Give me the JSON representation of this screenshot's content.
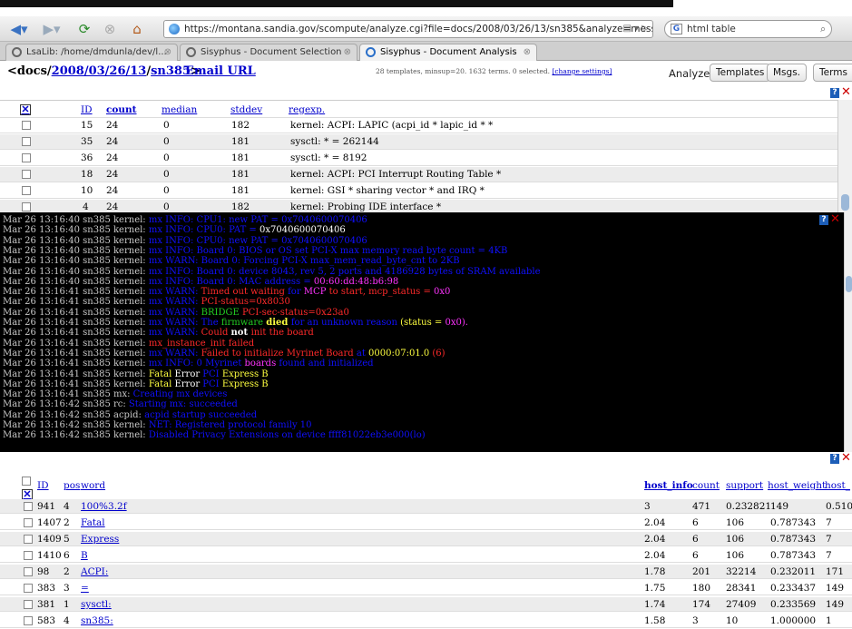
{
  "browser": {
    "url": "https://montana.sandia.gov/scompute/analyze.cgi?file=docs/2008/03/26/13/sn385&analyze=messages",
    "search_text": "html table",
    "tabs": [
      {
        "label": "LsaLib: /home/dmdunla/dev/l..."
      },
      {
        "label": "Sisyphus - Document Selection"
      },
      {
        "label": "Sisyphus - Document Analysis"
      }
    ]
  },
  "header": {
    "crumb_lt": "<",
    "crumb_docs": "docs",
    "crumb_slash1": "/",
    "crumb_date": "2008/03/26/13",
    "crumb_slash2": "/",
    "crumb_host": "sn385",
    "crumb_gt": ">",
    "email_url": "Email URL",
    "stats": "28 templates, minsup=20. 1632 terms. 0 selected.",
    "change_settings": "[change settings]",
    "analyze_label": "Analyze:",
    "buttons": [
      "Templates",
      "Msgs.",
      "Terms"
    ]
  },
  "templates": {
    "columns": {
      "id": "ID",
      "count": "count",
      "median": "median",
      "stddev": "stddev",
      "regexp": "regexp."
    },
    "rows": [
      {
        "id": "15",
        "count": "24",
        "median": "0",
        "stddev": "182",
        "regexp": "kernel: ACPI: LAPIC (acpi_id * lapic_id * *"
      },
      {
        "id": "35",
        "count": "24",
        "median": "0",
        "stddev": "181",
        "regexp": "sysctl: * = 262144"
      },
      {
        "id": "36",
        "count": "24",
        "median": "0",
        "stddev": "181",
        "regexp": "sysctl: * = 8192"
      },
      {
        "id": "18",
        "count": "24",
        "median": "0",
        "stddev": "181",
        "regexp": "kernel: ACPI: PCI Interrupt Routing Table *"
      },
      {
        "id": "10",
        "count": "24",
        "median": "0",
        "stddev": "181",
        "regexp": "kernel: GSI * sharing vector * and IRQ *"
      },
      {
        "id": "4",
        "count": "24",
        "median": "0",
        "stddev": "182",
        "regexp": "kernel: Probing IDE interface *"
      }
    ]
  },
  "log": {
    "lines": [
      {
        "ts": "Mar 26 13:16:40 sn385 kernel:",
        "segs": [
          {
            "t": " mx INFO: CPU1: new PAT = 0x7040600070406",
            "c": "c-blue"
          }
        ]
      },
      {
        "ts": "Mar 26 13:16:40 sn385 kernel:",
        "segs": [
          {
            "t": " mx INFO: CPU0: PAT = ",
            "c": "c-blue"
          },
          {
            "t": "0x7040600070406",
            "c": "c-white"
          }
        ]
      },
      {
        "ts": "Mar 26 13:16:40 sn385 kernel:",
        "segs": [
          {
            "t": " mx INFO: CPU0: new PAT = 0x7040600070406",
            "c": "c-blue"
          }
        ]
      },
      {
        "ts": "Mar 26 13:16:40 sn385 kernel:",
        "segs": [
          {
            "t": " mx INFO: Board 0: BIOS or OS set PCI-X max memory read byte count = 4KB",
            "c": "c-blue"
          }
        ]
      },
      {
        "ts": "Mar 26 13:16:40 sn385 kernel:",
        "segs": [
          {
            "t": " mx WARN: Board 0: Forcing PCI-X max_mem_read_byte_cnt to 2KB",
            "c": "c-blue"
          }
        ]
      },
      {
        "ts": "Mar 26 13:16:40 sn385 kernel:",
        "segs": [
          {
            "t": " mx INFO: Board 0: device 8043, rev 5, 2 ports and 4186928 bytes of SRAM available",
            "c": "c-blue"
          }
        ]
      },
      {
        "ts": "Mar 26 13:16:40 sn385 kernel:",
        "segs": [
          {
            "t": " mx INFO: Board 0: MAC address = ",
            "c": "c-blue"
          },
          {
            "t": "00:60:dd:48:b6:98",
            "c": "c-mag"
          }
        ]
      },
      {
        "ts": "Mar 26 13:16:41 sn385 kernel:",
        "segs": [
          {
            "t": " mx WARN: ",
            "c": "c-blue"
          },
          {
            "t": "Timed out waiting ",
            "c": "c-red"
          },
          {
            "t": "for ",
            "c": "c-blue"
          },
          {
            "t": "MCP ",
            "c": "c-mag"
          },
          {
            "t": "to start, mcp_status = ",
            "c": "c-red"
          },
          {
            "t": "0x0",
            "c": "c-mag"
          }
        ]
      },
      {
        "ts": "Mar 26 13:16:41 sn385 kernel:",
        "segs": [
          {
            "t": " mx WARN: ",
            "c": "c-blue"
          },
          {
            "t": "PCI-status=0x8030",
            "c": "c-red"
          }
        ]
      },
      {
        "ts": "Mar 26 13:16:41 sn385 kernel:",
        "segs": [
          {
            "t": " mx WARN: ",
            "c": "c-blue"
          },
          {
            "t": "BRIDGE ",
            "c": "c-green"
          },
          {
            "t": "PCI-sec-status=0x23a0",
            "c": "c-red"
          }
        ]
      },
      {
        "ts": "Mar 26 13:16:41 sn385 kernel:",
        "segs": [
          {
            "t": " mx WARN: ",
            "c": "c-blue"
          },
          {
            "t": "The ",
            "c": "c-blue"
          },
          {
            "t": "firmware ",
            "c": "c-green"
          },
          {
            "t": "died ",
            "c": "c-yellow c-bold"
          },
          {
            "t": "for an unknown reason ",
            "c": "c-blue"
          },
          {
            "t": "(status = ",
            "c": "c-yellow"
          },
          {
            "t": "0x0).",
            "c": "c-mag"
          }
        ]
      },
      {
        "ts": "Mar 26 13:16:41 sn385 kernel:",
        "segs": [
          {
            "t": " mx WARN: ",
            "c": "c-blue"
          },
          {
            "t": "Could ",
            "c": "c-red"
          },
          {
            "t": "not ",
            "c": "c-white c-bold"
          },
          {
            "t": "init the board",
            "c": "c-red"
          }
        ]
      },
      {
        "ts": "Mar 26 13:16:41 sn385 kernel:",
        "segs": [
          {
            "t": " mx_instance_init failed",
            "c": "c-red"
          }
        ]
      },
      {
        "ts": "Mar 26 13:16:41 sn385 kernel:",
        "segs": [
          {
            "t": " mx WARN: ",
            "c": "c-blue"
          },
          {
            "t": "Failed to initialize Myrinet Board ",
            "c": "c-red"
          },
          {
            "t": "at ",
            "c": "c-blue"
          },
          {
            "t": "0000:07:01.0 ",
            "c": "c-yellow"
          },
          {
            "t": "(6)",
            "c": "c-red"
          }
        ]
      },
      {
        "ts": "Mar 26 13:16:41 sn385 kernel:",
        "segs": [
          {
            "t": " mx INFO: 0 Myrinet ",
            "c": "c-blue"
          },
          {
            "t": "boards ",
            "c": "c-mag"
          },
          {
            "t": "found and initialized",
            "c": "c-blue"
          }
        ]
      },
      {
        "ts": "Mar 26 13:16:41 sn385 kernel:",
        "segs": [
          {
            "t": " Fatal ",
            "c": "c-yellow"
          },
          {
            "t": "Error ",
            "c": "c-white"
          },
          {
            "t": "PCI ",
            "c": "c-blue"
          },
          {
            "t": "Express B",
            "c": "c-yellow"
          }
        ]
      },
      {
        "ts": "Mar 26 13:16:41 sn385 kernel:",
        "segs": [
          {
            "t": " Fatal ",
            "c": "c-yellow"
          },
          {
            "t": "Error ",
            "c": "c-white"
          },
          {
            "t": "PCI ",
            "c": "c-blue"
          },
          {
            "t": "Express B",
            "c": "c-yellow"
          }
        ]
      },
      {
        "ts": "Mar 26 13:16:41 sn385 mx:",
        "segs": [
          {
            "t": " Creating mx devices",
            "c": "c-blue"
          }
        ]
      },
      {
        "ts": "Mar 26 13:16:42 sn385 rc:",
        "segs": [
          {
            "t": " Starting mx: succeeded",
            "c": "c-blue"
          }
        ]
      },
      {
        "ts": "Mar 26 13:16:42 sn385 acpid:",
        "segs": [
          {
            "t": " acpid startup succeeded",
            "c": "c-blue"
          }
        ]
      },
      {
        "ts": "Mar 26 13:16:42 sn385 kernel:",
        "segs": [
          {
            "t": " NET: Registered protocol family 10",
            "c": "c-blue"
          }
        ]
      },
      {
        "ts": "Mar 26 13:16:42 sn385 kernel:",
        "segs": [
          {
            "t": " Disabled Privacy Extensions on device ffff81022eb3e000(lo)",
            "c": "c-blue"
          }
        ]
      }
    ]
  },
  "words": {
    "columns": {
      "id": "ID",
      "pos": "pos",
      "word": "word",
      "host_info": "host_info",
      "count": "count",
      "support": "support",
      "host_weight": "host_weight",
      "host": "host_"
    },
    "rows": [
      {
        "id": "941",
        "pos": "4",
        "word": "100%3.2f",
        "host_info": "3",
        "count": "471",
        "support": "0.232821",
        "host_weight": "149",
        "host": "0.510"
      },
      {
        "id": "1407",
        "pos": "2",
        "word": "Fatal",
        "host_info": "2.04",
        "count": "6",
        "support": "106",
        "host_weight": "0.787343",
        "host": "7"
      },
      {
        "id": "1409",
        "pos": "5",
        "word": "Express",
        "host_info": "2.04",
        "count": "6",
        "support": "106",
        "host_weight": "0.787343",
        "host": "7"
      },
      {
        "id": "1410",
        "pos": "6",
        "word": "B",
        "host_info": "2.04",
        "count": "6",
        "support": "106",
        "host_weight": "0.787343",
        "host": "7"
      },
      {
        "id": "98",
        "pos": "2",
        "word": "ACPI:",
        "host_info": "1.78",
        "count": "201",
        "support": "32214",
        "host_weight": "0.232011",
        "host": "171"
      },
      {
        "id": "383",
        "pos": "3",
        "word": "=",
        "host_info": "1.75",
        "count": "180",
        "support": "28341",
        "host_weight": "0.233437",
        "host": "149"
      },
      {
        "id": "381",
        "pos": "1",
        "word": "sysctl:",
        "host_info": "1.74",
        "count": "174",
        "support": "27409",
        "host_weight": "0.233569",
        "host": "149"
      },
      {
        "id": "583",
        "pos": "4",
        "word": "sn385:",
        "host_info": "1.58",
        "count": "3",
        "support": "10",
        "host_weight": "1.000000",
        "host": "1"
      }
    ]
  }
}
